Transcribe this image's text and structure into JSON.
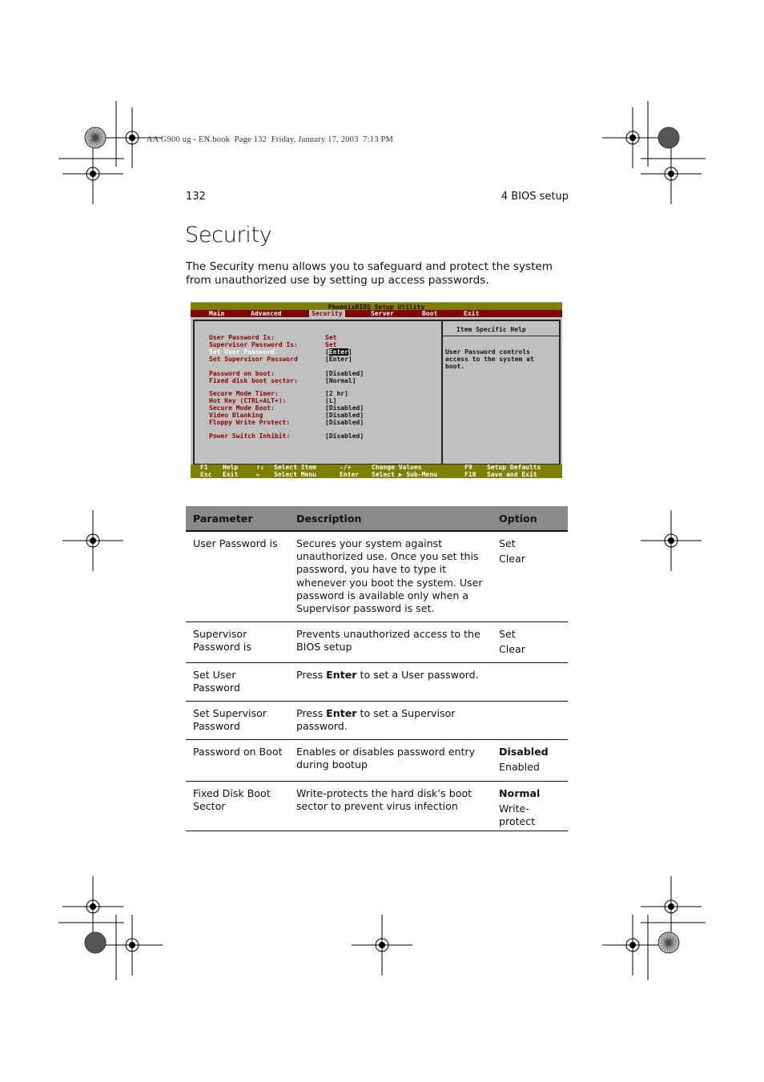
{
  "stamp": "AA G900 ug - EN.book  Page 132  Friday, January 17, 2003  7:13 PM",
  "page_number": "132",
  "chapter": "4 BIOS setup",
  "title": "Security",
  "intro": "The Security menu allows you to safeguard and protect the system from unauthorized use by setting up access passwords.",
  "bios": {
    "title": "PhoenixBIOS Setup Utility",
    "menu": [
      "Main",
      "Advanced",
      "Security",
      "Server",
      "Boot",
      "Exit"
    ],
    "selected_menu": "Security",
    "items": [
      {
        "label": "User Password Is:",
        "value": "Set"
      },
      {
        "label": "Supervisor Password Is:",
        "value": "Set"
      },
      {
        "label": "Set User Password",
        "value_pre": "[",
        "value_hl": "Enter",
        "value_post": "]"
      },
      {
        "label": "Set Supervisor Password",
        "value": "[Enter]"
      },
      {
        "label": "Password on boot:",
        "value": "[Disabled]"
      },
      {
        "label": "Fixed disk boot sector:",
        "value": "[Normal]"
      },
      {
        "label": "Secure Mode Timer:",
        "value": "[2 hr]"
      },
      {
        "label": "Hot Key (CTRL+ALT+):",
        "value": "[L]"
      },
      {
        "label": "Secure Mode Boot:",
        "value": "[Disabled]"
      },
      {
        "label": "Video Blanking",
        "value": "[Disabled]"
      },
      {
        "label": "Floppy Write Protect:",
        "value": "[Disabled]"
      },
      {
        "label": "Power Switch Inhibit:",
        "value": "[Disabled]"
      }
    ],
    "help_title": "Item Specific Help",
    "help_lines": [
      "User Password controls",
      "access to the system at",
      "boot."
    ],
    "footer": [
      [
        "F1",
        "Help",
        "↑↓",
        "Select Item",
        "-/+",
        "Change Values",
        "F9",
        "Setup Defaults"
      ],
      [
        "Esc",
        "Exit",
        "←",
        "Select Menu",
        "Enter",
        "Select ▶ Sub-Menu",
        "F10",
        "Save and Exit"
      ]
    ],
    "colors": {
      "title_bar": "#808000",
      "menu_bar": "#800000",
      "panel": "#c0c0c0",
      "label_text": "#8b0000"
    }
  },
  "table": {
    "headers": [
      "Parameter",
      "Description",
      "Option"
    ],
    "rows": [
      {
        "param": "User Password is",
        "desc_pre": "Secures your system against unauthorized use.  Once you set this password, you have to type it whenever you boot the system.  User password is available only when a Supervisor password is set.",
        "desc_bold": "",
        "desc_post": "",
        "options": [
          {
            "text": "Set",
            "default": false
          },
          {
            "text": "Clear",
            "default": false
          }
        ]
      },
      {
        "param": "Supervisor Password is",
        "desc_pre": "Prevents unauthorized access to the BIOS setup",
        "desc_bold": "",
        "desc_post": "",
        "options": [
          {
            "text": "Set",
            "default": false
          },
          {
            "text": "Clear",
            "default": false
          }
        ]
      },
      {
        "param": "Set User Password",
        "desc_pre": "Press ",
        "desc_bold": "Enter",
        "desc_post": " to set a User password.",
        "options": []
      },
      {
        "param": "Set Supervisor Password",
        "desc_pre": "Press ",
        "desc_bold": "Enter",
        "desc_post": " to set a Supervisor password.",
        "options": []
      },
      {
        "param": "Password on Boot",
        "desc_pre": "Enables or disables password entry during bootup",
        "desc_bold": "",
        "desc_post": "",
        "options": [
          {
            "text": "Disabled",
            "default": true
          },
          {
            "text": "Enabled",
            "default": false
          }
        ]
      },
      {
        "param": "Fixed Disk Boot Sector",
        "desc_pre": "Write-protects the hard disk’s boot sector to prevent virus infection",
        "desc_bold": "",
        "desc_post": "",
        "options": [
          {
            "text": "Normal",
            "default": true
          },
          {
            "text": "Write-protect",
            "default": false
          }
        ]
      }
    ]
  }
}
